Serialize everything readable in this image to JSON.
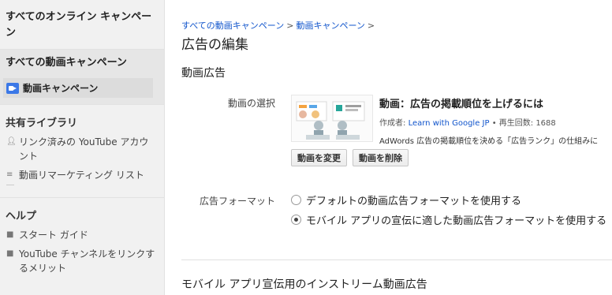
{
  "sidebar": {
    "top_title": "すべてのオンライン キャンペーン",
    "section_title": "すべての動画キャンペーン",
    "active_item": "動画キャンペーン",
    "library_header": "共有ライブラリ",
    "library_items": [
      {
        "label": "リンク済みの YouTube アカウント",
        "icon": "person-icon"
      },
      {
        "label": "動画リマーケティング リスト",
        "icon": "list-icon"
      }
    ],
    "help_header": "ヘルプ",
    "help_items": [
      {
        "label": "スタート ガイド",
        "icon": "help-icon"
      },
      {
        "label": "YouTube チャンネルをリンクするメリット",
        "icon": "help-icon"
      }
    ]
  },
  "breadcrumb": {
    "item1": "すべての動画キャンペーン",
    "item2": "動画キャンペーン",
    "sep": ">"
  },
  "page": {
    "title": "広告の編集",
    "section": "動画広告",
    "video_label": "動画の選択",
    "format_label": "広告フォーマット",
    "bottom_section": "モバイル アプリ宣伝用のインストリーム動画広告"
  },
  "video": {
    "title": "動画：広告の掲載順位を上げるには",
    "author_prefix": "作成者: ",
    "author": "Learn with Google JP",
    "views": " • 再生回数: 1688",
    "description": "AdWords 広告の掲載順位を決める「広告ランク」の仕組みに",
    "change_button": "動画を変更",
    "delete_button": "動画を削除"
  },
  "format_options": [
    {
      "label": "デフォルトの動画広告フォーマットを使用する",
      "checked": false
    },
    {
      "label": "モバイル アプリの宣伝に適した動画広告フォーマットを使用する",
      "checked": true
    }
  ]
}
